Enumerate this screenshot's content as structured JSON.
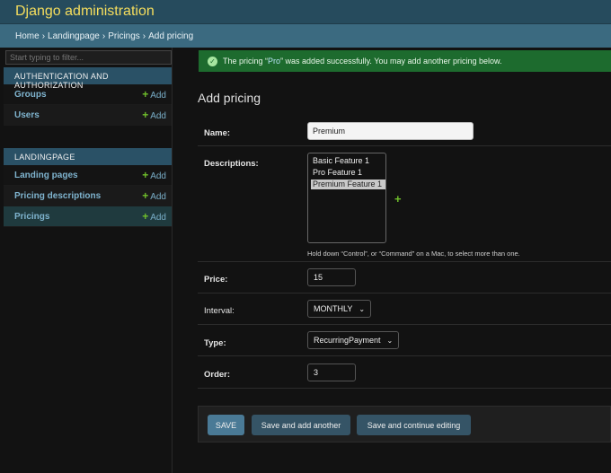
{
  "header": {
    "title": "Django administration"
  },
  "breadcrumbs": {
    "items": [
      "Home",
      "Landingpage",
      "Pricings",
      "Add pricing"
    ],
    "separator": "›"
  },
  "sidebar": {
    "filter_placeholder": "Start typing to filter...",
    "modules": [
      {
        "caption": "AUTHENTICATION AND AUTHORIZATION",
        "models": [
          {
            "name": "Groups",
            "add": "Add"
          },
          {
            "name": "Users",
            "add": "Add"
          }
        ]
      },
      {
        "caption": "LANDINGPAGE",
        "models": [
          {
            "name": "Landing pages",
            "add": "Add"
          },
          {
            "name": "Pricing descriptions",
            "add": "Add"
          },
          {
            "name": "Pricings",
            "add": "Add"
          }
        ]
      }
    ]
  },
  "message": {
    "prefix": "The pricing “",
    "object": "Pro",
    "suffix": "” was added successfully. You may add another pricing below."
  },
  "page_title": "Add pricing",
  "form": {
    "name": {
      "label": "Name:",
      "value": "Premium"
    },
    "descriptions": {
      "label": "Descriptions:",
      "options": [
        "Basic Feature 1",
        "Pro Feature 1",
        "Premium Feature 1"
      ],
      "selected": "Premium Feature 1",
      "help": "Hold down “Control”, or “Command” on a Mac, to select more than one."
    },
    "price": {
      "label": "Price:",
      "value": "15"
    },
    "interval": {
      "label": "Interval:",
      "value": "MONTHLY"
    },
    "type": {
      "label": "Type:",
      "value": "RecurringPayment"
    },
    "order": {
      "label": "Order:",
      "value": "3"
    }
  },
  "buttons": {
    "save": "SAVE",
    "save_add_another": "Save and add another",
    "save_continue": "Save and continue editing"
  },
  "colors": {
    "header_title": "#f5dd5d",
    "success": "#1d6b2e",
    "add_plus": "#70bf2b",
    "link": "#7fb4cf"
  },
  "icons": {
    "add": "plus-icon",
    "success": "check-circle-icon",
    "dropdown": "chevron-down-icon"
  }
}
